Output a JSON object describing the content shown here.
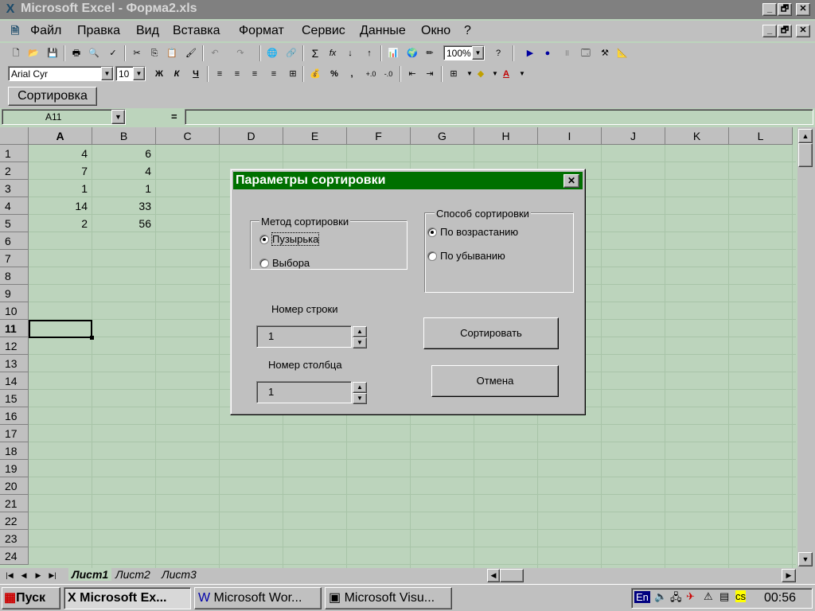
{
  "window": {
    "title": "Microsoft Excel - Форма2.xls",
    "app_icon": "excel-icon",
    "controls": {
      "minimize": "_",
      "restore": "🗗",
      "close": "✕"
    }
  },
  "menu": [
    {
      "label": "Файл"
    },
    {
      "label": "Правка"
    },
    {
      "label": "Вид"
    },
    {
      "label": "Вставка"
    },
    {
      "label": "Формат"
    },
    {
      "label": "Сервис"
    },
    {
      "label": "Данные"
    },
    {
      "label": "Окно"
    },
    {
      "label": "?"
    }
  ],
  "standard_toolbar": {
    "zoom": "100%"
  },
  "format_toolbar": {
    "font_name": "Arial Cyr",
    "font_size": "10",
    "bold": "Ж",
    "italic": "К",
    "underline": "Ч",
    "percent": "%",
    "comma": ","
  },
  "custom_toolbar": {
    "sort_button": "Сортировка"
  },
  "formula_bar": {
    "name_box": "A11",
    "equals": "="
  },
  "sheet": {
    "columns": [
      "A",
      "B",
      "C",
      "D",
      "E",
      "F",
      "G",
      "H",
      "I",
      "J",
      "K",
      "L"
    ],
    "rows": [
      "1",
      "2",
      "3",
      "4",
      "5",
      "6",
      "7",
      "8",
      "9",
      "10",
      "11",
      "12",
      "13",
      "14",
      "15",
      "16",
      "17",
      "18",
      "19",
      "20",
      "21",
      "22",
      "23",
      "24"
    ],
    "active_cell": "A11",
    "data": [
      {
        "a": "4",
        "b": "6"
      },
      {
        "a": "7",
        "b": "4"
      },
      {
        "a": "1",
        "b": "1"
      },
      {
        "a": "14",
        "b": "33"
      },
      {
        "a": "2",
        "b": "56"
      }
    ]
  },
  "sheet_tabs": [
    "Лист1",
    "Лист2",
    "Лист3"
  ],
  "dialog": {
    "title": "Параметры сортировки",
    "method_group": {
      "label": "Метод сортировки",
      "options": [
        {
          "label": "Пузырька",
          "selected": true
        },
        {
          "label": "Выбора",
          "selected": false
        }
      ]
    },
    "order_group": {
      "label": "Способ сортировки",
      "options": [
        {
          "label": "По возрастанию",
          "selected": true
        },
        {
          "label": "По убыванию",
          "selected": false
        }
      ]
    },
    "row_label": "Номер строки",
    "row_value": "1",
    "col_label": "Номер столбца",
    "col_value": "1",
    "sort_button": "Сортировать",
    "cancel_button": "Отмена"
  },
  "taskbar": {
    "start": "Пуск",
    "tasks": [
      {
        "label": "Microsoft Ex..."
      },
      {
        "label": "Microsoft Wor..."
      },
      {
        "label": "Microsoft Visu..."
      }
    ],
    "lang": "En",
    "clock": "00:56"
  },
  "colors": {
    "dialog_title": "#007000",
    "grid_bg": "#bcd4bc",
    "chrome": "#c0c0c0"
  }
}
